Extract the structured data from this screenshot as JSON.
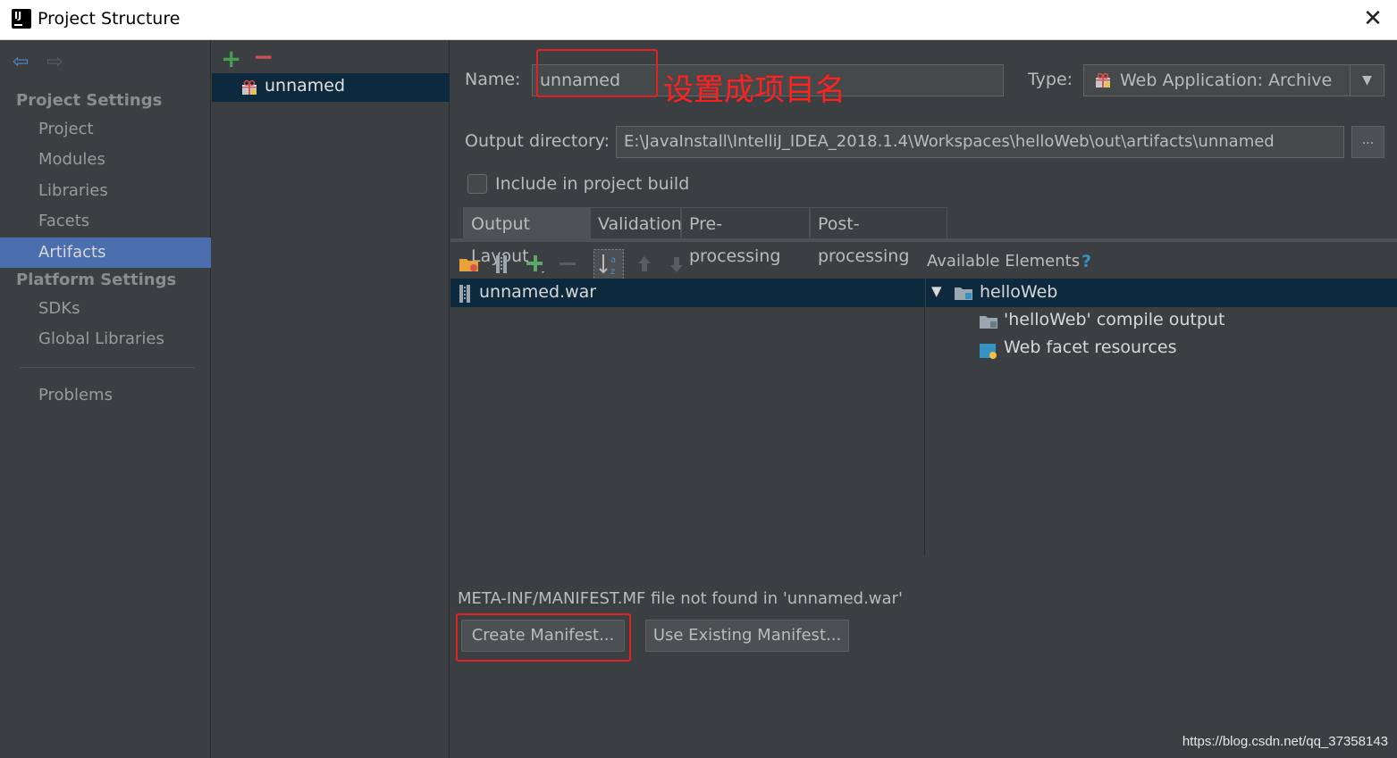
{
  "window": {
    "title": "Project Structure",
    "close_glyph": "✕"
  },
  "sidebar": {
    "back_glyph": "⇦",
    "forward_glyph": "⇨",
    "project_settings_title": "Project Settings",
    "project_items": [
      "Project",
      "Modules",
      "Libraries",
      "Facets",
      "Artifacts"
    ],
    "active_item": "Artifacts",
    "platform_settings_title": "Platform Settings",
    "platform_items": [
      "SDKs",
      "Global Libraries"
    ],
    "problems_label": "Problems"
  },
  "artifacts_list": {
    "add_glyph": "+",
    "remove_glyph": "−",
    "items": [
      "unnamed"
    ]
  },
  "form": {
    "name_label": "Name:",
    "name_value": "unnamed",
    "type_label": "Type:",
    "type_value": "Web Application: Archive",
    "output_dir_label": "Output directory:",
    "output_dir_value": "E:\\JavaInstall\\IntelliJ_IDEA_2018.1.4\\Workspaces\\helloWeb\\out\\artifacts\\unnamed",
    "browse_label": "...",
    "include_label": "Include in project build",
    "include_checked": false
  },
  "annotation": {
    "text": "设置成项目名",
    "color": "#ff2020"
  },
  "tabs": [
    "Output Layout",
    "Validation",
    "Pre-processing",
    "Post-processing"
  ],
  "active_tab": "Output Layout",
  "output_layout": {
    "tree_items": [
      "unnamed.war"
    ],
    "available_title": "Available Elements",
    "help_glyph": "?",
    "available_root": "helloWeb",
    "available_children": [
      "'helloWeb' compile output",
      "Web facet resources"
    ],
    "manifest_warning": "META-INF/MANIFEST.MF file not found in 'unnamed.war'",
    "create_manifest_label": "Create Manifest...",
    "use_existing_label": "Use Existing Manifest..."
  },
  "watermark": "https://blog.csdn.net/qq_37358143",
  "colors": {
    "accent": "#4b6eaf",
    "selection": "#0d293e",
    "annotation": "#e22222",
    "add": "#499c54",
    "remove": "#c75450"
  }
}
